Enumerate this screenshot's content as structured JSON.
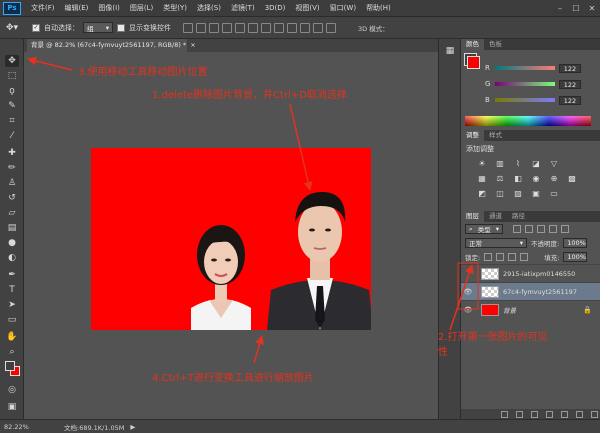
{
  "menubar": {
    "logo": "Ps",
    "items": [
      "文件(F)",
      "编辑(E)",
      "图像(I)",
      "图层(L)",
      "类型(Y)",
      "选择(S)",
      "滤镜(T)",
      "3D(D)",
      "视图(V)",
      "窗口(W)",
      "帮助(H)"
    ]
  },
  "options": {
    "auto_select_label": "自动选择：",
    "auto_select_value": "组",
    "transform_controls_label": "显示变换控件",
    "mode_3d_label": "3D 模式："
  },
  "document": {
    "tab_title": "背景 @ 82.2% (67c4-fymvuyt2561197, RGB/8) *"
  },
  "panels": {
    "color_tabs": [
      "颜色",
      "色板"
    ],
    "rgb": [
      {
        "letter": "R",
        "value": "122"
      },
      {
        "letter": "G",
        "value": "122"
      },
      {
        "letter": "B",
        "value": "122"
      }
    ],
    "adjust_tabs": [
      "调整",
      "样式"
    ],
    "adjust_title": "添加调整",
    "layers_tabs": [
      "图层",
      "通道",
      "路径"
    ],
    "filter_label": "类型",
    "blend_mode": "正常",
    "opacity_label": "不透明度:",
    "opacity_value": "100%",
    "lock_label": "锁定:",
    "fill_label": "填充:",
    "fill_value": "100%",
    "layers": [
      {
        "name": "2915-iatixpm0146550",
        "thumb": "chk",
        "eye": "",
        "selected": false
      },
      {
        "name": "67c4-fymvuyt2561197",
        "thumb": "chk",
        "eye": "👁",
        "selected": true
      },
      {
        "name": "背景",
        "thumb": "red",
        "eye": "👁",
        "selected": false
      }
    ]
  },
  "annotations": {
    "step1": "1.delete删除图片背景，并Ctrl+D取消选择",
    "step2_line1": "2.打开第一张图片的可见",
    "step2_line2": "性",
    "step3": "3.使用移动工具移动图片位置",
    "step4": "4.Ctrl+T进行变换工具进行缩放图片"
  },
  "status": {
    "zoom": "82.22%",
    "doc_info": "文档:689.1K/1.05M",
    "arrow": "▶"
  },
  "colors": {
    "annotation": "#e3331f",
    "canvas_bg": "#ff0000",
    "selected_layer": "#6b7a8c"
  }
}
